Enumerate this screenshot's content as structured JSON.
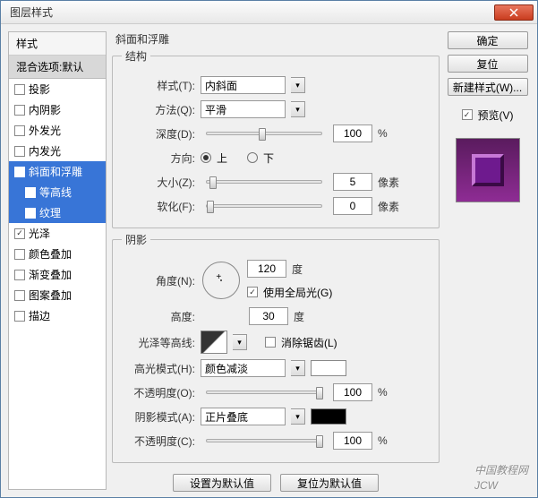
{
  "window": {
    "title": "图层样式",
    "watermark1": "中国教程网",
    "watermark2": "JCW"
  },
  "leftPanel": {
    "header": "样式",
    "subheader": "混合选项:默认",
    "items": [
      {
        "label": "投影",
        "checked": false
      },
      {
        "label": "内阴影",
        "checked": false
      },
      {
        "label": "外发光",
        "checked": false
      },
      {
        "label": "内发光",
        "checked": false
      },
      {
        "label": "斜面和浮雕",
        "checked": true,
        "selected": true
      },
      {
        "label": "等高线",
        "checked": true,
        "sub": true,
        "selected": true
      },
      {
        "label": "纹理",
        "checked": false,
        "sub": true,
        "selected": true
      },
      {
        "label": "光泽",
        "checked": true
      },
      {
        "label": "颜色叠加",
        "checked": false
      },
      {
        "label": "渐变叠加",
        "checked": false
      },
      {
        "label": "图案叠加",
        "checked": false
      },
      {
        "label": "描边",
        "checked": false
      }
    ]
  },
  "center": {
    "mainTitle": "斜面和浮雕",
    "structure": {
      "legend": "结构",
      "styleLabel": "样式(T):",
      "styleValue": "内斜面",
      "methodLabel": "方法(Q):",
      "methodValue": "平滑",
      "depthLabel": "深度(D):",
      "depthValue": "100",
      "percent": "%",
      "directionLabel": "方向:",
      "up": "上",
      "down": "下",
      "sizeLabel": "大小(Z):",
      "sizeValue": "5",
      "pxUnit": "像素",
      "softenLabel": "软化(F):",
      "softenValue": "0"
    },
    "shading": {
      "legend": "阴影",
      "angleLabel": "角度(N):",
      "angleValue": "120",
      "deg": "度",
      "globalLight": "使用全局光(G)",
      "altitudeLabel": "高度:",
      "altitudeValue": "30",
      "glossContourLabel": "光泽等高线:",
      "antialias": "消除锯齿(L)",
      "highlightModeLabel": "高光模式(H):",
      "highlightModeValue": "颜色减淡",
      "highlightColor": "#ffffff",
      "highlightOpacityLabel": "不透明度(O):",
      "highlightOpacityValue": "100",
      "shadowModeLabel": "阴影模式(A):",
      "shadowModeValue": "正片叠底",
      "shadowColor": "#000000",
      "shadowOpacityLabel": "不透明度(C):",
      "shadowOpacityValue": "100"
    },
    "buttons": {
      "setDefault": "设置为默认值",
      "resetDefault": "复位为默认值"
    }
  },
  "right": {
    "ok": "确定",
    "reset": "复位",
    "newStyle": "新建样式(W)...",
    "previewLabel": "预览(V)"
  }
}
